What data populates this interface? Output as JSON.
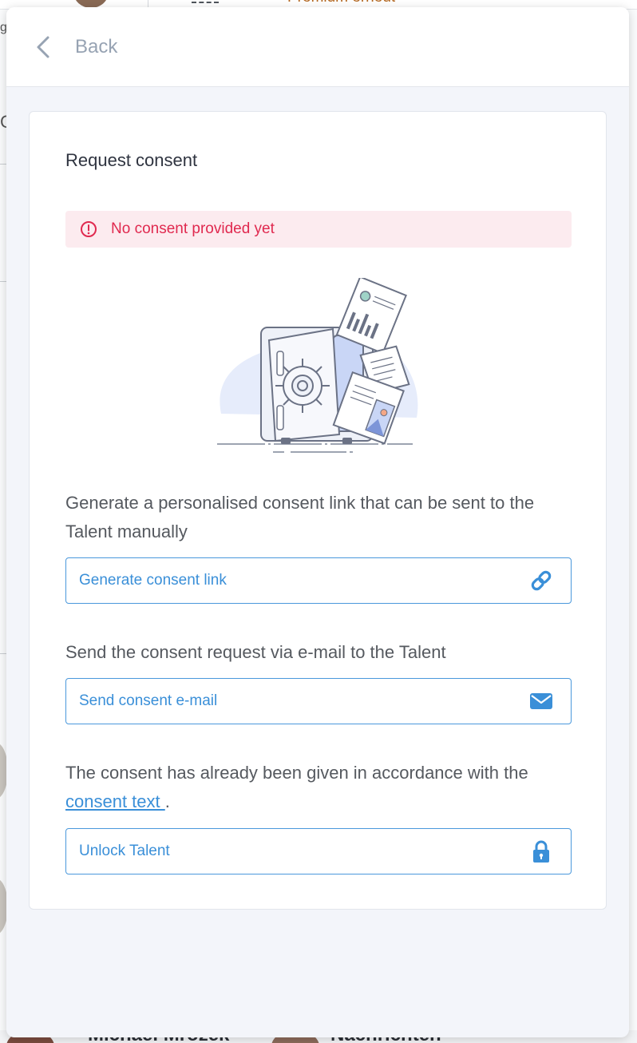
{
  "background": {
    "premium_label": "Premium erneut",
    "left_char_1": "g",
    "left_char_2": "C",
    "bottom_name": "Michael Mrozek",
    "bottom_messages": "Nachrichten"
  },
  "header": {
    "back_label": "Back"
  },
  "card": {
    "title": "Request consent",
    "alert": {
      "text": "No consent provided yet",
      "color": "#e0294f",
      "icon": "alert-circle-icon"
    },
    "illustration": "safe-with-documents",
    "sections": [
      {
        "description": "Generate a personalised consent link that can be sent to the Talent manually",
        "button_label": "Generate consent link",
        "icon": "link-icon"
      },
      {
        "description": "Send the consent request via e-mail to the Talent",
        "button_label": "Send consent e-mail",
        "icon": "envelope-icon"
      },
      {
        "description_before": "The consent has already been given in accordance with the",
        "link_text": "consent text ",
        "description_after": ".",
        "button_label": "Unlock Talent",
        "icon": "lock-icon"
      }
    ]
  },
  "colors": {
    "accent": "#3a8fd8",
    "alert_bg": "#fcebef",
    "panel_bg": "#f3f5fa"
  }
}
